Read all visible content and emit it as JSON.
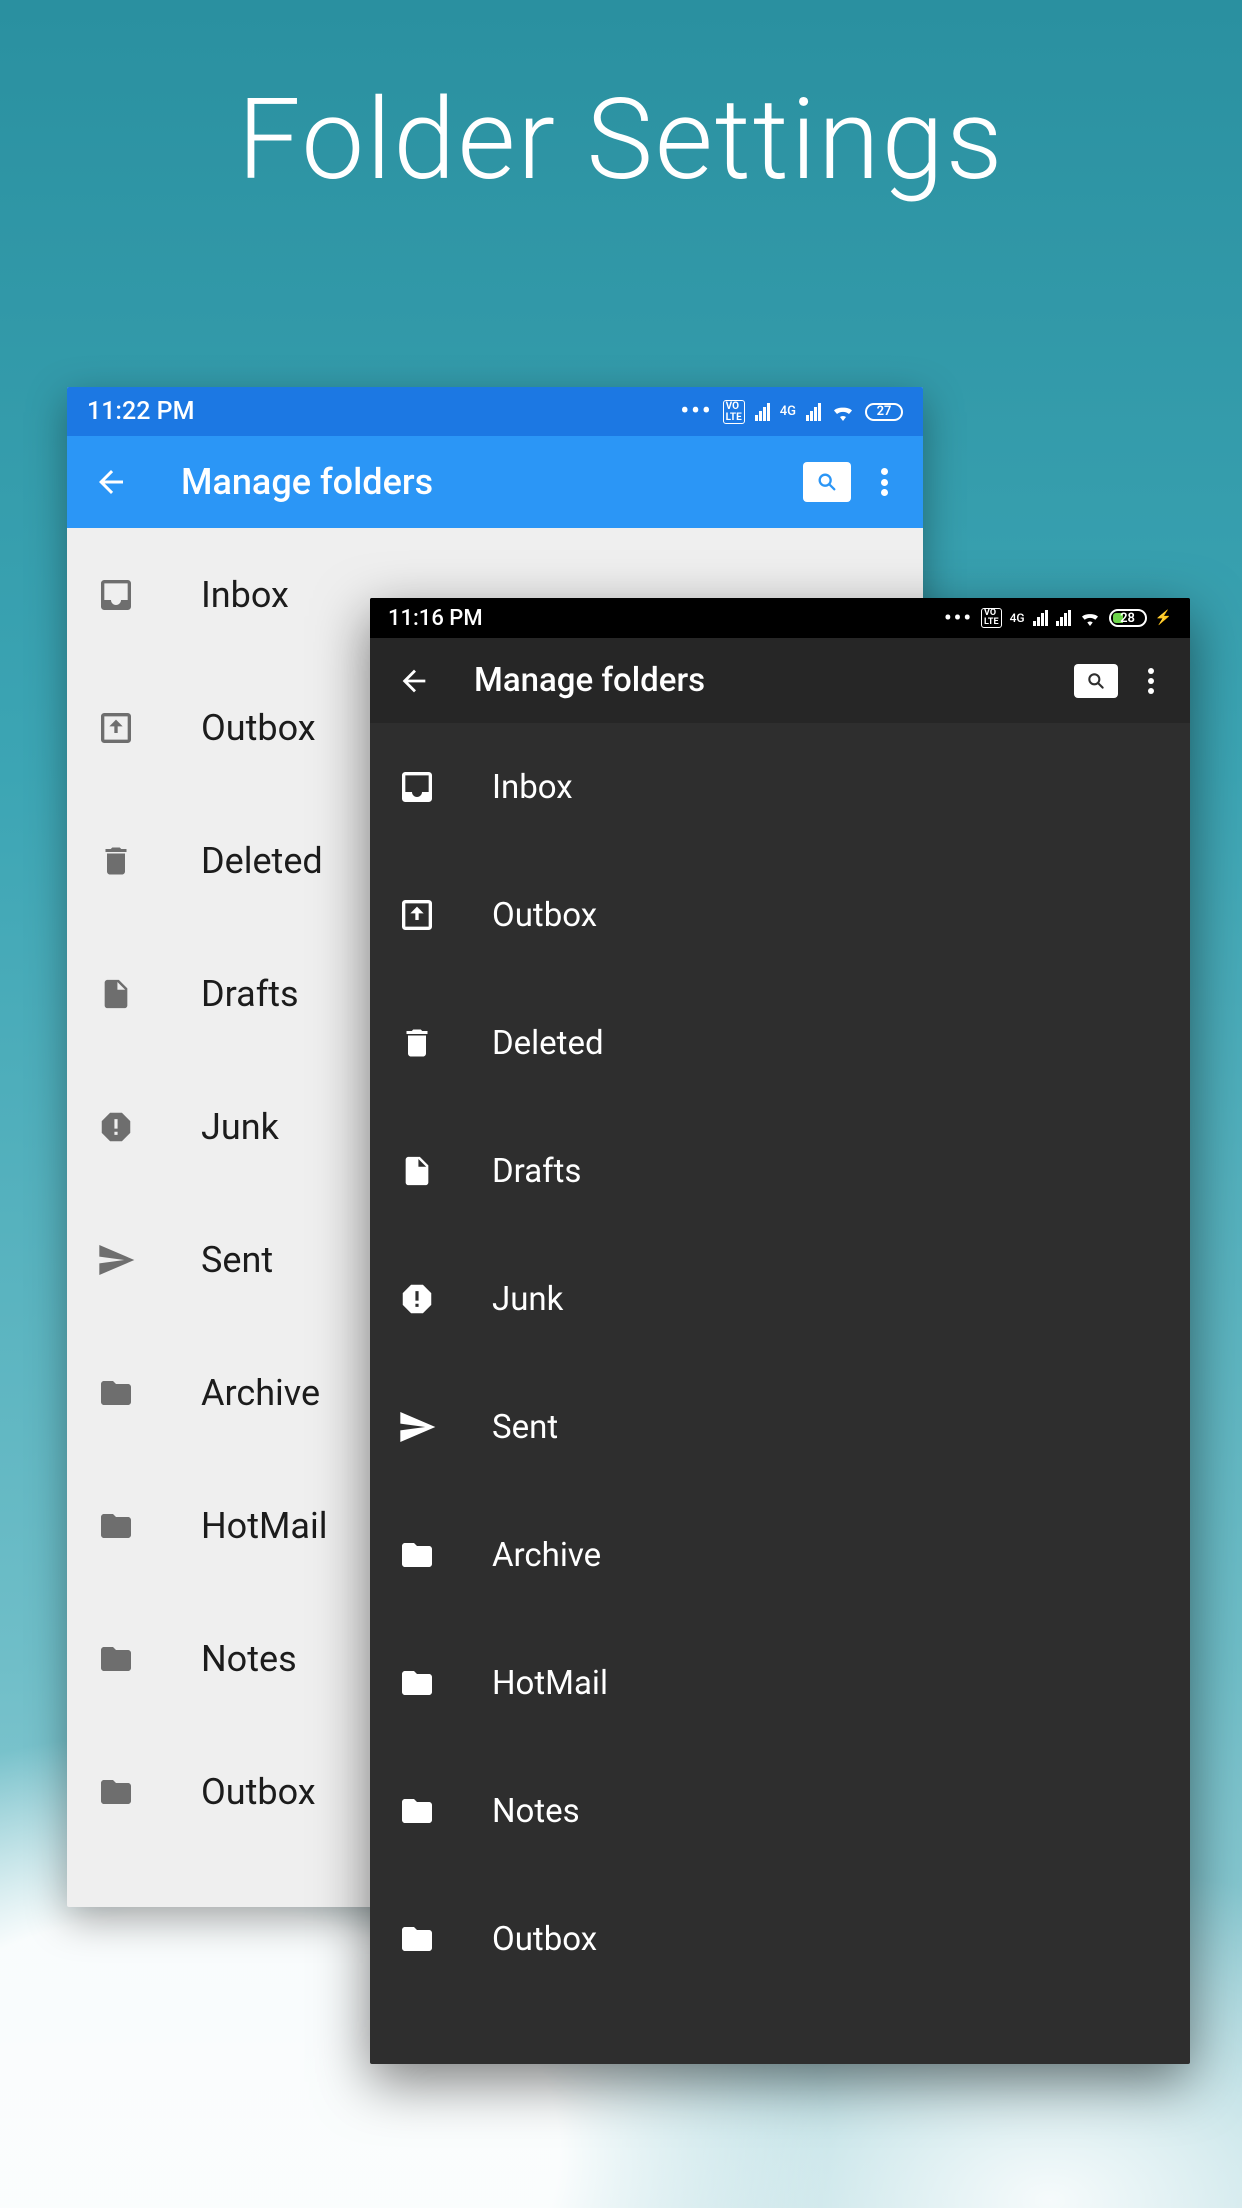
{
  "page_title": "Folder Settings",
  "light": {
    "status": {
      "time": "11:22 PM",
      "network_label": "4G",
      "battery": "27"
    },
    "appbar": {
      "title": "Manage folders"
    },
    "folders": [
      {
        "icon": "inbox",
        "label": "Inbox"
      },
      {
        "icon": "outbox",
        "label": "Outbox"
      },
      {
        "icon": "trash",
        "label": "Deleted"
      },
      {
        "icon": "file",
        "label": "Drafts"
      },
      {
        "icon": "junk",
        "label": "Junk"
      },
      {
        "icon": "sent",
        "label": "Sent"
      },
      {
        "icon": "folder",
        "label": "Archive"
      },
      {
        "icon": "folder",
        "label": "HotMail"
      },
      {
        "icon": "folder",
        "label": "Notes"
      },
      {
        "icon": "folder",
        "label": "Outbox"
      }
    ]
  },
  "dark": {
    "status": {
      "time": "11:16 PM",
      "network_label": "4G",
      "battery": "28"
    },
    "appbar": {
      "title": "Manage folders"
    },
    "folders": [
      {
        "icon": "inbox",
        "label": "Inbox"
      },
      {
        "icon": "outbox",
        "label": "Outbox"
      },
      {
        "icon": "trash",
        "label": "Deleted"
      },
      {
        "icon": "file",
        "label": "Drafts"
      },
      {
        "icon": "junk",
        "label": "Junk"
      },
      {
        "icon": "sent",
        "label": "Sent"
      },
      {
        "icon": "folder",
        "label": "Archive"
      },
      {
        "icon": "folder",
        "label": "HotMail"
      },
      {
        "icon": "folder",
        "label": "Notes"
      },
      {
        "icon": "folder",
        "label": "Outbox"
      }
    ]
  }
}
